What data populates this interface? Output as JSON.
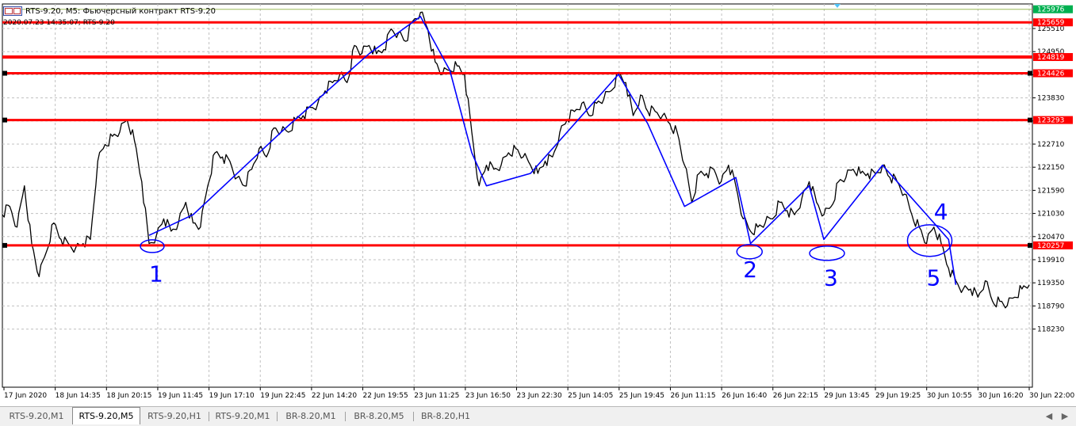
{
  "window": {
    "title": "RTS-9.20, M5:  Фьючерсный контракт RTS-9.20",
    "subtitle": "2020.07.23 14:35:07; RTS-9.20"
  },
  "colors": {
    "level_line": "#ff0000",
    "trend_line": "#0000ff",
    "price_series": "#000000",
    "grid": "#c0c0c0",
    "price_tag_red": "#ff0000",
    "price_tag_green": "#00b050"
  },
  "chart_data": {
    "type": "line",
    "title": "",
    "xlabel": "",
    "ylabel": "",
    "ylim": [
      118000,
      126000
    ],
    "y_ticks": [
      {
        "value": 125510,
        "label": "125510"
      },
      {
        "value": 124950,
        "label": "124950"
      },
      {
        "value": 124390,
        "label": "124390"
      },
      {
        "value": 123830,
        "label": "123830"
      },
      {
        "value": 123270,
        "label": "123270"
      },
      {
        "value": 122710,
        "label": "122710"
      },
      {
        "value": 122150,
        "label": "122150"
      },
      {
        "value": 121590,
        "label": "121590"
      },
      {
        "value": 121030,
        "label": "121030"
      },
      {
        "value": 120470,
        "label": "120470"
      },
      {
        "value": 119910,
        "label": "119910"
      },
      {
        "value": 119350,
        "label": "119350"
      },
      {
        "value": 118790,
        "label": "118790"
      },
      {
        "value": 118230,
        "label": "118230"
      }
    ],
    "x_labels": [
      "17 Jun 2020",
      "18 Jun 14:35",
      "18 Jun 20:15",
      "19 Jun 11:45",
      "19 Jun 17:10",
      "19 Jun 22:45",
      "22 Jun 14:20",
      "22 Jun 19:55",
      "23 Jun 11:25",
      "23 Jun 16:50",
      "23 Jun 22:30",
      "25 Jun 14:05",
      "25 Jun 19:45",
      "26 Jun 11:15",
      "26 Jun 16:40",
      "26 Jun 22:15",
      "29 Jun 13:45",
      "29 Jun 19:25",
      "30 Jun 10:55",
      "30 Jun 16:20",
      "30 Jun 22:00"
    ],
    "levels": [
      {
        "value": 125976,
        "label": "125976",
        "style": "top"
      },
      {
        "value": 125659,
        "label": "125659",
        "style": "red"
      },
      {
        "value": 124819,
        "label": "124819",
        "style": "red"
      },
      {
        "value": 124426,
        "label": "124426",
        "style": "red"
      },
      {
        "value": 123293,
        "label": "123293",
        "style": "red"
      },
      {
        "value": 120257,
        "label": "120257",
        "style": "red"
      }
    ],
    "series": [
      {
        "style": "price",
        "points": [
          [
            0,
            121000
          ],
          [
            1,
            121200
          ],
          [
            2,
            120700
          ],
          [
            3,
            121700
          ],
          [
            4,
            120300
          ],
          [
            5,
            119500
          ],
          [
            6,
            120100
          ],
          [
            7,
            120800
          ],
          [
            8,
            120400
          ],
          [
            9,
            120300
          ],
          [
            10,
            120200
          ],
          [
            11,
            120300
          ],
          [
            12,
            120400
          ],
          [
            13,
            122300
          ],
          [
            14,
            122700
          ],
          [
            15,
            122900
          ],
          [
            16,
            123000
          ],
          [
            17,
            123300
          ],
          [
            18,
            122800
          ],
          [
            19,
            121800
          ],
          [
            20,
            120300
          ],
          [
            21,
            120500
          ],
          [
            22,
            120900
          ],
          [
            23,
            120600
          ],
          [
            24,
            120800
          ],
          [
            25,
            121300
          ],
          [
            26,
            120800
          ],
          [
            27,
            120700
          ],
          [
            28,
            121700
          ],
          [
            29,
            122500
          ],
          [
            30,
            122400
          ],
          [
            31,
            122300
          ],
          [
            32,
            121900
          ],
          [
            33,
            121700
          ],
          [
            34,
            122100
          ],
          [
            35,
            122600
          ],
          [
            36,
            122400
          ],
          [
            37,
            123100
          ],
          [
            38,
            123000
          ],
          [
            39,
            123000
          ],
          [
            40,
            123300
          ],
          [
            41,
            123400
          ],
          [
            42,
            123600
          ],
          [
            43,
            123700
          ],
          [
            44,
            124000
          ],
          [
            45,
            124200
          ],
          [
            46,
            124400
          ],
          [
            47,
            124200
          ],
          [
            48,
            125100
          ],
          [
            49,
            124900
          ],
          [
            50,
            125100
          ],
          [
            51,
            124900
          ],
          [
            52,
            125000
          ],
          [
            53,
            125500
          ],
          [
            54,
            125400
          ],
          [
            55,
            125200
          ],
          [
            56,
            125700
          ],
          [
            57,
            125900
          ],
          [
            58,
            125500
          ],
          [
            59,
            124700
          ],
          [
            60,
            124400
          ],
          [
            61,
            124500
          ],
          [
            62,
            124600
          ],
          [
            63,
            124400
          ],
          [
            64,
            123000
          ],
          [
            65,
            121700
          ],
          [
            66,
            122200
          ],
          [
            67,
            122100
          ],
          [
            68,
            122200
          ],
          [
            69,
            122500
          ],
          [
            70,
            122600
          ],
          [
            71,
            122400
          ],
          [
            72,
            122200
          ],
          [
            73,
            122000
          ],
          [
            74,
            122300
          ],
          [
            75,
            122400
          ],
          [
            76,
            123000
          ],
          [
            77,
            123300
          ],
          [
            78,
            123500
          ],
          [
            79,
            123700
          ],
          [
            80,
            123400
          ],
          [
            81,
            123700
          ],
          [
            82,
            123800
          ],
          [
            83,
            124000
          ],
          [
            84,
            124400
          ],
          [
            85,
            124200
          ],
          [
            86,
            123400
          ],
          [
            87,
            123900
          ],
          [
            88,
            123500
          ],
          [
            89,
            123500
          ],
          [
            90,
            123400
          ],
          [
            91,
            123200
          ],
          [
            92,
            123000
          ],
          [
            93,
            122200
          ],
          [
            94,
            121300
          ],
          [
            95,
            122000
          ],
          [
            96,
            122000
          ],
          [
            97,
            122100
          ],
          [
            98,
            121800
          ],
          [
            99,
            122200
          ],
          [
            100,
            121700
          ],
          [
            101,
            120900
          ],
          [
            102,
            120600
          ],
          [
            103,
            120700
          ],
          [
            104,
            120800
          ],
          [
            105,
            120900
          ],
          [
            106,
            121300
          ],
          [
            107,
            121100
          ],
          [
            108,
            121000
          ],
          [
            109,
            121400
          ],
          [
            110,
            121800
          ],
          [
            111,
            121300
          ],
          [
            112,
            121000
          ],
          [
            113,
            121200
          ],
          [
            114,
            121800
          ],
          [
            115,
            121900
          ],
          [
            116,
            122100
          ],
          [
            117,
            122000
          ],
          [
            118,
            122000
          ],
          [
            119,
            122000
          ],
          [
            120,
            122200
          ],
          [
            121,
            121900
          ],
          [
            122,
            121800
          ],
          [
            123,
            121500
          ],
          [
            124,
            121000
          ],
          [
            125,
            120700
          ],
          [
            126,
            120300
          ],
          [
            127,
            120700
          ],
          [
            128,
            120300
          ],
          [
            129,
            119700
          ],
          [
            130,
            119400
          ],
          [
            131,
            119200
          ],
          [
            132,
            119200
          ],
          [
            133,
            119000
          ],
          [
            134,
            119400
          ],
          [
            135,
            118900
          ],
          [
            136,
            118900
          ],
          [
            137,
            118800
          ],
          [
            138,
            119000
          ],
          [
            139,
            119200
          ],
          [
            140,
            119300
          ]
        ]
      },
      {
        "style": "trend",
        "points": [
          [
            20,
            120500
          ],
          [
            26,
            121000
          ],
          [
            38,
            123000
          ],
          [
            50,
            124900
          ],
          [
            57,
            125800
          ],
          [
            61,
            124500
          ],
          [
            64,
            122500
          ],
          [
            66,
            121700
          ],
          [
            72,
            122000
          ],
          [
            84,
            124400
          ],
          [
            88,
            123200
          ],
          [
            93,
            121200
          ],
          [
            100,
            121900
          ],
          [
            102,
            120300
          ],
          [
            110,
            121700
          ],
          [
            112,
            120400
          ],
          [
            120,
            122200
          ],
          [
            129,
            120400
          ],
          [
            130,
            119300
          ]
        ]
      }
    ],
    "annotations": [
      {
        "text": "1",
        "x": 20,
        "y": 119500
      },
      {
        "text": "2",
        "x": 101,
        "y": 119600
      },
      {
        "text": "3",
        "x": 112,
        "y": 119400
      },
      {
        "text": "4",
        "x": 127,
        "y": 121000
      },
      {
        "text": "5",
        "x": 126,
        "y": 119400
      }
    ]
  },
  "tabs": [
    {
      "label": "RTS-9.20,M1",
      "active": false
    },
    {
      "label": "RTS-9.20,M5",
      "active": true
    },
    {
      "label": "RTS-9.20,H1",
      "active": false
    },
    {
      "label": "RTS-9.20,M1",
      "active": false
    },
    {
      "label": "BR-8.20,M1",
      "active": false
    },
    {
      "label": "BR-8.20,M5",
      "active": false
    },
    {
      "label": "BR-8.20,H1",
      "active": false
    }
  ],
  "scroll": {
    "left": "◀",
    "right": "▶"
  }
}
